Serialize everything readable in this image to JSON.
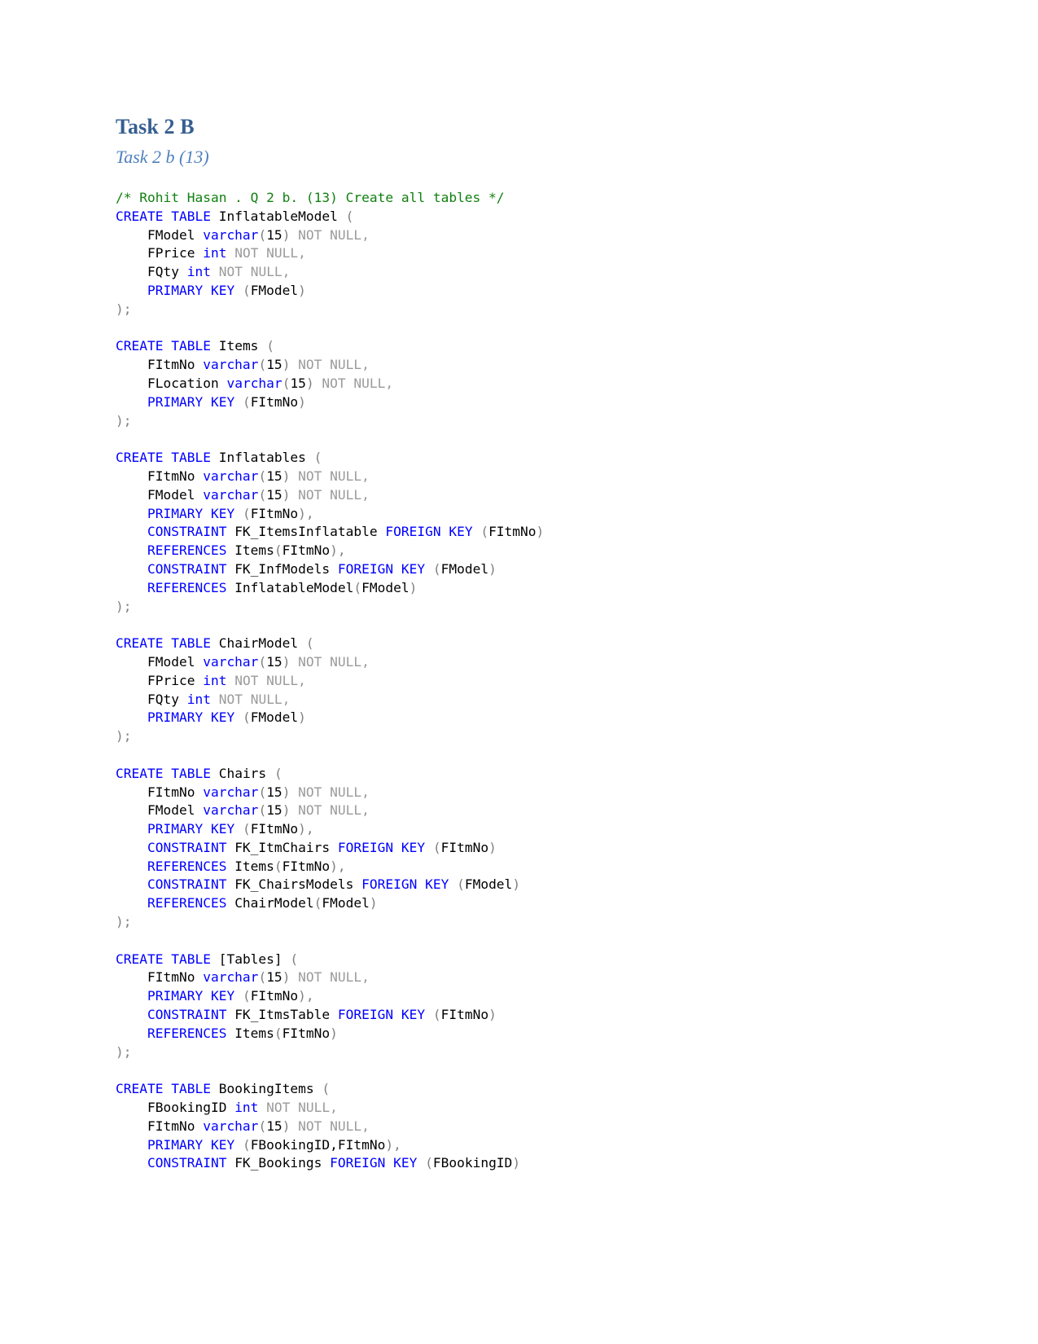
{
  "document": {
    "title": "Task 2 B",
    "subtitle": "Task 2 b (13)"
  },
  "colors": {
    "heading": "#365f91",
    "subheading": "#4f81bd",
    "keyword": "#0000ff",
    "comment": "#108010",
    "muted": "#9a9a9a",
    "identifier": "#000000",
    "page_background": "#ffffff"
  },
  "code": {
    "language": "sql",
    "lines": [
      [
        {
          "t": "/* Rohit Hasan . Q 2 b. (13) Create all tables */",
          "c": "cmt"
        }
      ],
      [
        {
          "t": "CREATE TABLE ",
          "c": "kw"
        },
        {
          "t": "InflatableModel ",
          "c": "id"
        },
        {
          "t": "(",
          "c": "punc"
        }
      ],
      [
        {
          "t": "    FModel ",
          "c": "id"
        },
        {
          "t": "varchar",
          "c": "kw"
        },
        {
          "t": "(",
          "c": "punc"
        },
        {
          "t": "15",
          "c": "num"
        },
        {
          "t": ")",
          "c": "punc"
        },
        {
          "t": " NOT NULL,",
          "c": "gray"
        }
      ],
      [
        {
          "t": "    FPrice ",
          "c": "id"
        },
        {
          "t": "int",
          "c": "kw"
        },
        {
          "t": " NOT NULL,",
          "c": "gray"
        }
      ],
      [
        {
          "t": "    FQty ",
          "c": "id"
        },
        {
          "t": "int",
          "c": "kw"
        },
        {
          "t": " NOT NULL,",
          "c": "gray"
        }
      ],
      [
        {
          "t": "    PRIMARY KEY ",
          "c": "kw"
        },
        {
          "t": "(",
          "c": "punc"
        },
        {
          "t": "FModel",
          "c": "id"
        },
        {
          "t": ")",
          "c": "punc"
        }
      ],
      [
        {
          "t": ");",
          "c": "punc"
        }
      ],
      [],
      [
        {
          "t": "CREATE TABLE ",
          "c": "kw"
        },
        {
          "t": "Items ",
          "c": "id"
        },
        {
          "t": "(",
          "c": "punc"
        }
      ],
      [
        {
          "t": "    FItmNo ",
          "c": "id"
        },
        {
          "t": "varchar",
          "c": "kw"
        },
        {
          "t": "(",
          "c": "punc"
        },
        {
          "t": "15",
          "c": "num"
        },
        {
          "t": ")",
          "c": "punc"
        },
        {
          "t": " NOT NULL,",
          "c": "gray"
        }
      ],
      [
        {
          "t": "    FLocation ",
          "c": "id"
        },
        {
          "t": "varchar",
          "c": "kw"
        },
        {
          "t": "(",
          "c": "punc"
        },
        {
          "t": "15",
          "c": "num"
        },
        {
          "t": ")",
          "c": "punc"
        },
        {
          "t": " NOT NULL,",
          "c": "gray"
        }
      ],
      [
        {
          "t": "    PRIMARY KEY ",
          "c": "kw"
        },
        {
          "t": "(",
          "c": "punc"
        },
        {
          "t": "FItmNo",
          "c": "id"
        },
        {
          "t": ")",
          "c": "punc"
        }
      ],
      [
        {
          "t": ");",
          "c": "punc"
        }
      ],
      [],
      [
        {
          "t": "CREATE TABLE ",
          "c": "kw"
        },
        {
          "t": "Inflatables ",
          "c": "id"
        },
        {
          "t": "(",
          "c": "punc"
        }
      ],
      [
        {
          "t": "    FItmNo ",
          "c": "id"
        },
        {
          "t": "varchar",
          "c": "kw"
        },
        {
          "t": "(",
          "c": "punc"
        },
        {
          "t": "15",
          "c": "num"
        },
        {
          "t": ")",
          "c": "punc"
        },
        {
          "t": " NOT NULL,",
          "c": "gray"
        }
      ],
      [
        {
          "t": "    FModel ",
          "c": "id"
        },
        {
          "t": "varchar",
          "c": "kw"
        },
        {
          "t": "(",
          "c": "punc"
        },
        {
          "t": "15",
          "c": "num"
        },
        {
          "t": ")",
          "c": "punc"
        },
        {
          "t": " NOT NULL,",
          "c": "gray"
        }
      ],
      [
        {
          "t": "    PRIMARY KEY ",
          "c": "kw"
        },
        {
          "t": "(",
          "c": "punc"
        },
        {
          "t": "FItmNo",
          "c": "id"
        },
        {
          "t": "),",
          "c": "punc"
        }
      ],
      [
        {
          "t": "    CONSTRAINT ",
          "c": "kw"
        },
        {
          "t": "FK_ItemsInflatable ",
          "c": "id"
        },
        {
          "t": "FOREIGN KEY ",
          "c": "kw"
        },
        {
          "t": "(",
          "c": "punc"
        },
        {
          "t": "FItmNo",
          "c": "id"
        },
        {
          "t": ")",
          "c": "punc"
        }
      ],
      [
        {
          "t": "    REFERENCES ",
          "c": "kw"
        },
        {
          "t": "Items",
          "c": "id"
        },
        {
          "t": "(",
          "c": "punc"
        },
        {
          "t": "FItmNo",
          "c": "id"
        },
        {
          "t": "),",
          "c": "punc"
        }
      ],
      [
        {
          "t": "    CONSTRAINT ",
          "c": "kw"
        },
        {
          "t": "FK_InfModels ",
          "c": "id"
        },
        {
          "t": "FOREIGN KEY ",
          "c": "kw"
        },
        {
          "t": "(",
          "c": "punc"
        },
        {
          "t": "FModel",
          "c": "id"
        },
        {
          "t": ")",
          "c": "punc"
        }
      ],
      [
        {
          "t": "    REFERENCES ",
          "c": "kw"
        },
        {
          "t": "InflatableModel",
          "c": "id"
        },
        {
          "t": "(",
          "c": "punc"
        },
        {
          "t": "FModel",
          "c": "id"
        },
        {
          "t": ")",
          "c": "punc"
        }
      ],
      [
        {
          "t": ");",
          "c": "punc"
        }
      ],
      [],
      [
        {
          "t": "CREATE TABLE ",
          "c": "kw"
        },
        {
          "t": "ChairModel ",
          "c": "id"
        },
        {
          "t": "(",
          "c": "punc"
        }
      ],
      [
        {
          "t": "    FModel ",
          "c": "id"
        },
        {
          "t": "varchar",
          "c": "kw"
        },
        {
          "t": "(",
          "c": "punc"
        },
        {
          "t": "15",
          "c": "num"
        },
        {
          "t": ")",
          "c": "punc"
        },
        {
          "t": " NOT NULL,",
          "c": "gray"
        }
      ],
      [
        {
          "t": "    FPrice ",
          "c": "id"
        },
        {
          "t": "int",
          "c": "kw"
        },
        {
          "t": " NOT NULL,",
          "c": "gray"
        }
      ],
      [
        {
          "t": "    FQty ",
          "c": "id"
        },
        {
          "t": "int",
          "c": "kw"
        },
        {
          "t": " NOT NULL,",
          "c": "gray"
        }
      ],
      [
        {
          "t": "    PRIMARY KEY ",
          "c": "kw"
        },
        {
          "t": "(",
          "c": "punc"
        },
        {
          "t": "FModel",
          "c": "id"
        },
        {
          "t": ")",
          "c": "punc"
        }
      ],
      [
        {
          "t": ");",
          "c": "punc"
        }
      ],
      [],
      [
        {
          "t": "CREATE TABLE ",
          "c": "kw"
        },
        {
          "t": "Chairs ",
          "c": "id"
        },
        {
          "t": "(",
          "c": "punc"
        }
      ],
      [
        {
          "t": "    FItmNo ",
          "c": "id"
        },
        {
          "t": "varchar",
          "c": "kw"
        },
        {
          "t": "(",
          "c": "punc"
        },
        {
          "t": "15",
          "c": "num"
        },
        {
          "t": ")",
          "c": "punc"
        },
        {
          "t": " NOT NULL,",
          "c": "gray"
        }
      ],
      [
        {
          "t": "    FModel ",
          "c": "id"
        },
        {
          "t": "varchar",
          "c": "kw"
        },
        {
          "t": "(",
          "c": "punc"
        },
        {
          "t": "15",
          "c": "num"
        },
        {
          "t": ")",
          "c": "punc"
        },
        {
          "t": " NOT NULL,",
          "c": "gray"
        }
      ],
      [
        {
          "t": "    PRIMARY KEY ",
          "c": "kw"
        },
        {
          "t": "(",
          "c": "punc"
        },
        {
          "t": "FItmNo",
          "c": "id"
        },
        {
          "t": "),",
          "c": "punc"
        }
      ],
      [
        {
          "t": "    CONSTRAINT ",
          "c": "kw"
        },
        {
          "t": "FK_ItmChairs ",
          "c": "id"
        },
        {
          "t": "FOREIGN KEY ",
          "c": "kw"
        },
        {
          "t": "(",
          "c": "punc"
        },
        {
          "t": "FItmNo",
          "c": "id"
        },
        {
          "t": ")",
          "c": "punc"
        }
      ],
      [
        {
          "t": "    REFERENCES ",
          "c": "kw"
        },
        {
          "t": "Items",
          "c": "id"
        },
        {
          "t": "(",
          "c": "punc"
        },
        {
          "t": "FItmNo",
          "c": "id"
        },
        {
          "t": "),",
          "c": "punc"
        }
      ],
      [
        {
          "t": "    CONSTRAINT ",
          "c": "kw"
        },
        {
          "t": "FK_ChairsModels ",
          "c": "id"
        },
        {
          "t": "FOREIGN KEY ",
          "c": "kw"
        },
        {
          "t": "(",
          "c": "punc"
        },
        {
          "t": "FModel",
          "c": "id"
        },
        {
          "t": ")",
          "c": "punc"
        }
      ],
      [
        {
          "t": "    REFERENCES ",
          "c": "kw"
        },
        {
          "t": "ChairModel",
          "c": "id"
        },
        {
          "t": "(",
          "c": "punc"
        },
        {
          "t": "FModel",
          "c": "id"
        },
        {
          "t": ")",
          "c": "punc"
        }
      ],
      [
        {
          "t": ");",
          "c": "punc"
        }
      ],
      [],
      [
        {
          "t": "CREATE TABLE ",
          "c": "kw"
        },
        {
          "t": "[Tables] ",
          "c": "id"
        },
        {
          "t": "(",
          "c": "punc"
        }
      ],
      [
        {
          "t": "    FItmNo ",
          "c": "id"
        },
        {
          "t": "varchar",
          "c": "kw"
        },
        {
          "t": "(",
          "c": "punc"
        },
        {
          "t": "15",
          "c": "num"
        },
        {
          "t": ")",
          "c": "punc"
        },
        {
          "t": " NOT NULL,",
          "c": "gray"
        }
      ],
      [
        {
          "t": "    PRIMARY KEY ",
          "c": "kw"
        },
        {
          "t": "(",
          "c": "punc"
        },
        {
          "t": "FItmNo",
          "c": "id"
        },
        {
          "t": "),",
          "c": "punc"
        }
      ],
      [
        {
          "t": "    CONSTRAINT ",
          "c": "kw"
        },
        {
          "t": "FK_ItmsTable ",
          "c": "id"
        },
        {
          "t": "FOREIGN KEY ",
          "c": "kw"
        },
        {
          "t": "(",
          "c": "punc"
        },
        {
          "t": "FItmNo",
          "c": "id"
        },
        {
          "t": ")",
          "c": "punc"
        }
      ],
      [
        {
          "t": "    REFERENCES ",
          "c": "kw"
        },
        {
          "t": "Items",
          "c": "id"
        },
        {
          "t": "(",
          "c": "punc"
        },
        {
          "t": "FItmNo",
          "c": "id"
        },
        {
          "t": ")",
          "c": "punc"
        }
      ],
      [
        {
          "t": ");",
          "c": "punc"
        }
      ],
      [],
      [
        {
          "t": "CREATE TABLE ",
          "c": "kw"
        },
        {
          "t": "BookingItems ",
          "c": "id"
        },
        {
          "t": "(",
          "c": "punc"
        }
      ],
      [
        {
          "t": "    FBookingID ",
          "c": "id"
        },
        {
          "t": "int",
          "c": "kw"
        },
        {
          "t": " NOT NULL,",
          "c": "gray"
        }
      ],
      [
        {
          "t": "    FItmNo ",
          "c": "id"
        },
        {
          "t": "varchar",
          "c": "kw"
        },
        {
          "t": "(",
          "c": "punc"
        },
        {
          "t": "15",
          "c": "num"
        },
        {
          "t": ")",
          "c": "punc"
        },
        {
          "t": " NOT NULL,",
          "c": "gray"
        }
      ],
      [
        {
          "t": "    PRIMARY KEY ",
          "c": "kw"
        },
        {
          "t": "(",
          "c": "punc"
        },
        {
          "t": "FBookingID,FItmNo",
          "c": "id"
        },
        {
          "t": "),",
          "c": "punc"
        }
      ],
      [
        {
          "t": "    CONSTRAINT ",
          "c": "kw"
        },
        {
          "t": "FK_Bookings ",
          "c": "id"
        },
        {
          "t": "FOREIGN KEY ",
          "c": "kw"
        },
        {
          "t": "(",
          "c": "punc"
        },
        {
          "t": "FBookingID",
          "c": "id"
        },
        {
          "t": ")",
          "c": "punc"
        }
      ]
    ]
  }
}
